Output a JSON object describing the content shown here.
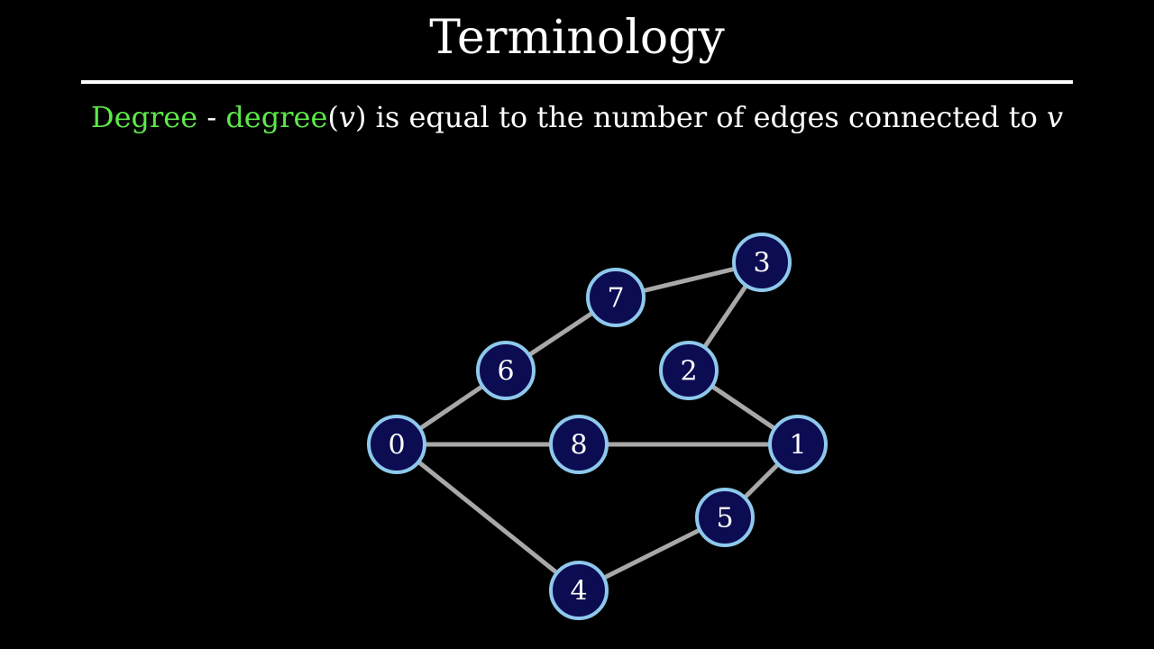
{
  "header": {
    "title": "Terminology"
  },
  "definition": {
    "term": "Degree",
    "separator": "-",
    "func": "degree",
    "paren_open": "(",
    "var": "v",
    "paren_close": ")",
    "text": "is equal to the number of edges connected to",
    "var_end": "v"
  },
  "colors": {
    "background": "#000000",
    "accent_green": "#5ee84a",
    "node_fill": "#0c0c52",
    "node_stroke": "#8ec8ec",
    "edge": "#a8a8a8"
  },
  "graph": {
    "nodes": [
      {
        "id": "0",
        "label": "0"
      },
      {
        "id": "1",
        "label": "1"
      },
      {
        "id": "2",
        "label": "2"
      },
      {
        "id": "3",
        "label": "3"
      },
      {
        "id": "4",
        "label": "4"
      },
      {
        "id": "5",
        "label": "5"
      },
      {
        "id": "6",
        "label": "6"
      },
      {
        "id": "7",
        "label": "7"
      },
      {
        "id": "8",
        "label": "8"
      }
    ],
    "edges": [
      {
        "from": "0",
        "to": "6"
      },
      {
        "from": "6",
        "to": "7"
      },
      {
        "from": "7",
        "to": "3"
      },
      {
        "from": "3",
        "to": "2"
      },
      {
        "from": "2",
        "to": "1"
      },
      {
        "from": "0",
        "to": "8"
      },
      {
        "from": "8",
        "to": "1"
      },
      {
        "from": "1",
        "to": "5"
      },
      {
        "from": "5",
        "to": "4"
      },
      {
        "from": "4",
        "to": "0"
      }
    ]
  }
}
